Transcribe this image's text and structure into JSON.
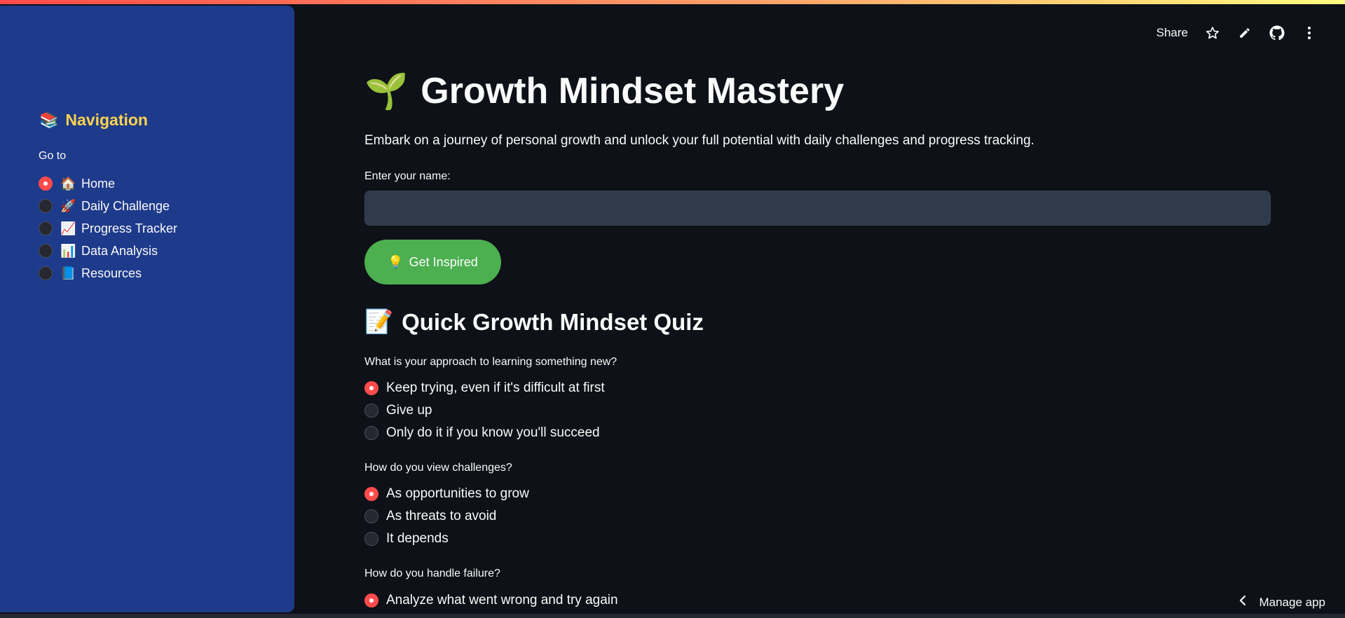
{
  "header": {
    "share_label": "Share",
    "icons": [
      "star-icon",
      "pencil-icon",
      "github-icon",
      "more-vertical-icon"
    ]
  },
  "sidebar": {
    "title_emoji": "📚",
    "title": "Navigation",
    "goto_label": "Go to",
    "items": [
      {
        "icon": "🏠",
        "label": "Home",
        "selected": true
      },
      {
        "icon": "🚀",
        "label": "Daily Challenge",
        "selected": false
      },
      {
        "icon": "📈",
        "label": "Progress Tracker",
        "selected": false
      },
      {
        "icon": "📊",
        "label": "Data Analysis",
        "selected": false
      },
      {
        "icon": "📘",
        "label": "Resources",
        "selected": false
      }
    ]
  },
  "main": {
    "title_emoji": "🌱",
    "title": "Growth Mindset Mastery",
    "intro": "Embark on a journey of personal growth and unlock your full potential with daily challenges and progress tracking.",
    "name_label": "Enter your name:",
    "name_value": "",
    "inspire_emoji": "💡",
    "inspire_label": "Get Inspired",
    "quiz_emoji": "📝",
    "quiz_title": "Quick Growth Mindset Quiz",
    "questions": [
      {
        "label": "What is your approach to learning something new?",
        "options": [
          "Keep trying, even if it's difficult at first",
          "Give up",
          "Only do it if you know you'll succeed"
        ],
        "selected": 0
      },
      {
        "label": "How do you view challenges?",
        "options": [
          "As opportunities to grow",
          "As threats to avoid",
          "It depends"
        ],
        "selected": 0
      },
      {
        "label": "How do you handle failure?",
        "options": [
          "Analyze what went wrong and try again"
        ],
        "selected": 0
      }
    ]
  },
  "footer": {
    "manage_app_label": "Manage app"
  },
  "colors": {
    "sidebar_bg": "#1e3a8a",
    "nav_title": "#fcd34d",
    "radio_selected": "#ff4b4b",
    "button_bg": "#4caf50",
    "app_bg": "#0e1117"
  }
}
